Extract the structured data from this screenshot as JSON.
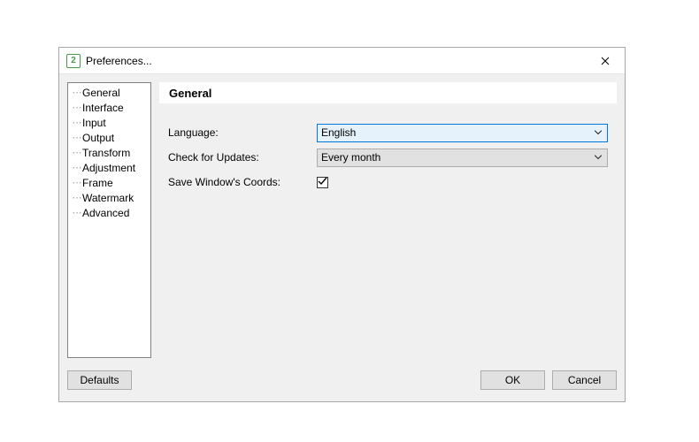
{
  "window": {
    "title": "Preferences...",
    "icon_glyph": "2"
  },
  "sidebar": {
    "items": [
      {
        "label": "General"
      },
      {
        "label": "Interface"
      },
      {
        "label": "Input"
      },
      {
        "label": "Output"
      },
      {
        "label": "Transform"
      },
      {
        "label": "Adjustment"
      },
      {
        "label": "Frame"
      },
      {
        "label": "Watermark"
      },
      {
        "label": "Advanced"
      }
    ]
  },
  "main": {
    "heading": "General",
    "language_label": "Language:",
    "language_value": "English",
    "updates_label": "Check for Updates:",
    "updates_value": "Every month",
    "coords_label": "Save Window's Coords:",
    "coords_checked": true
  },
  "footer": {
    "defaults_label": "Defaults",
    "ok_label": "OK",
    "cancel_label": "Cancel"
  }
}
